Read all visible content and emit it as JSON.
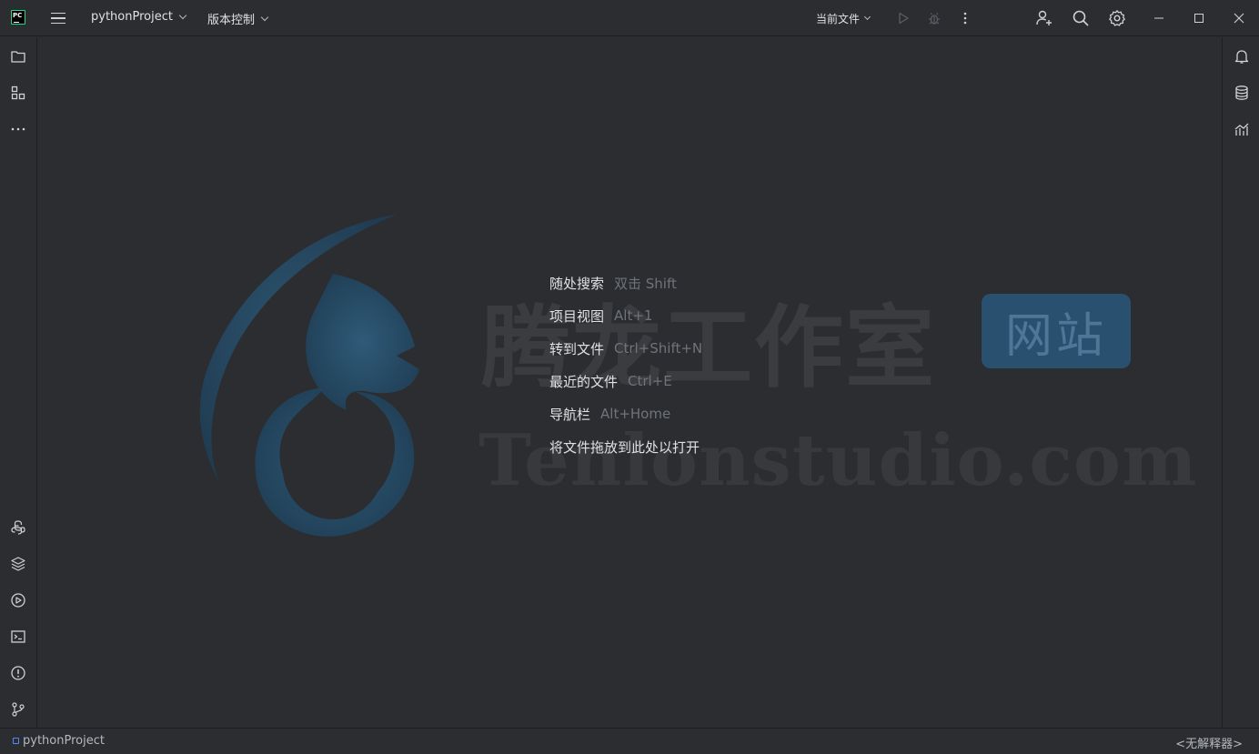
{
  "titlebar": {
    "app_logo_text": "PC",
    "project_name": "pythonProject",
    "vcs_label": "版本控制",
    "run_config": "当前文件",
    "icons": [
      "hamburger-menu-icon",
      "run-icon",
      "debug-icon",
      "more-vertical-icon",
      "add-user-icon",
      "search-icon",
      "settings-icon",
      "minimize-icon",
      "maximize-icon",
      "close-icon"
    ]
  },
  "left_toolbar": {
    "top_icons": [
      "project-folder-icon",
      "structure-icon",
      "more-tools-icon"
    ],
    "bottom_icons": [
      "python-console-icon",
      "python-packages-icon",
      "services-icon",
      "terminal-icon",
      "problems-icon",
      "git-icon"
    ]
  },
  "right_toolbar": {
    "icons": [
      "notifications-icon",
      "database-icon",
      "sciview-icon"
    ]
  },
  "welcome_hints": [
    {
      "label": "随处搜索",
      "shortcut": "双击 Shift"
    },
    {
      "label": "项目视图",
      "shortcut": "Alt+1"
    },
    {
      "label": "转到文件",
      "shortcut": "Ctrl+Shift+N"
    },
    {
      "label": "最近的文件",
      "shortcut": "Ctrl+E"
    },
    {
      "label": "导航栏",
      "shortcut": "Alt+Home"
    },
    {
      "label": "将文件拖放到此处以打开",
      "shortcut": ""
    }
  ],
  "watermark": {
    "chinese": "腾龙工作室",
    "badge": "网站",
    "english": "Tenlonstudio.com"
  },
  "statusbar": {
    "project": "pythonProject",
    "interpreter": "<无解释器>"
  },
  "colors": {
    "background": "#2b2d30",
    "text": "#dfe1e5",
    "muted": "#6f737a",
    "accent": "#548af7",
    "watermark_blue": "#2a5070"
  }
}
